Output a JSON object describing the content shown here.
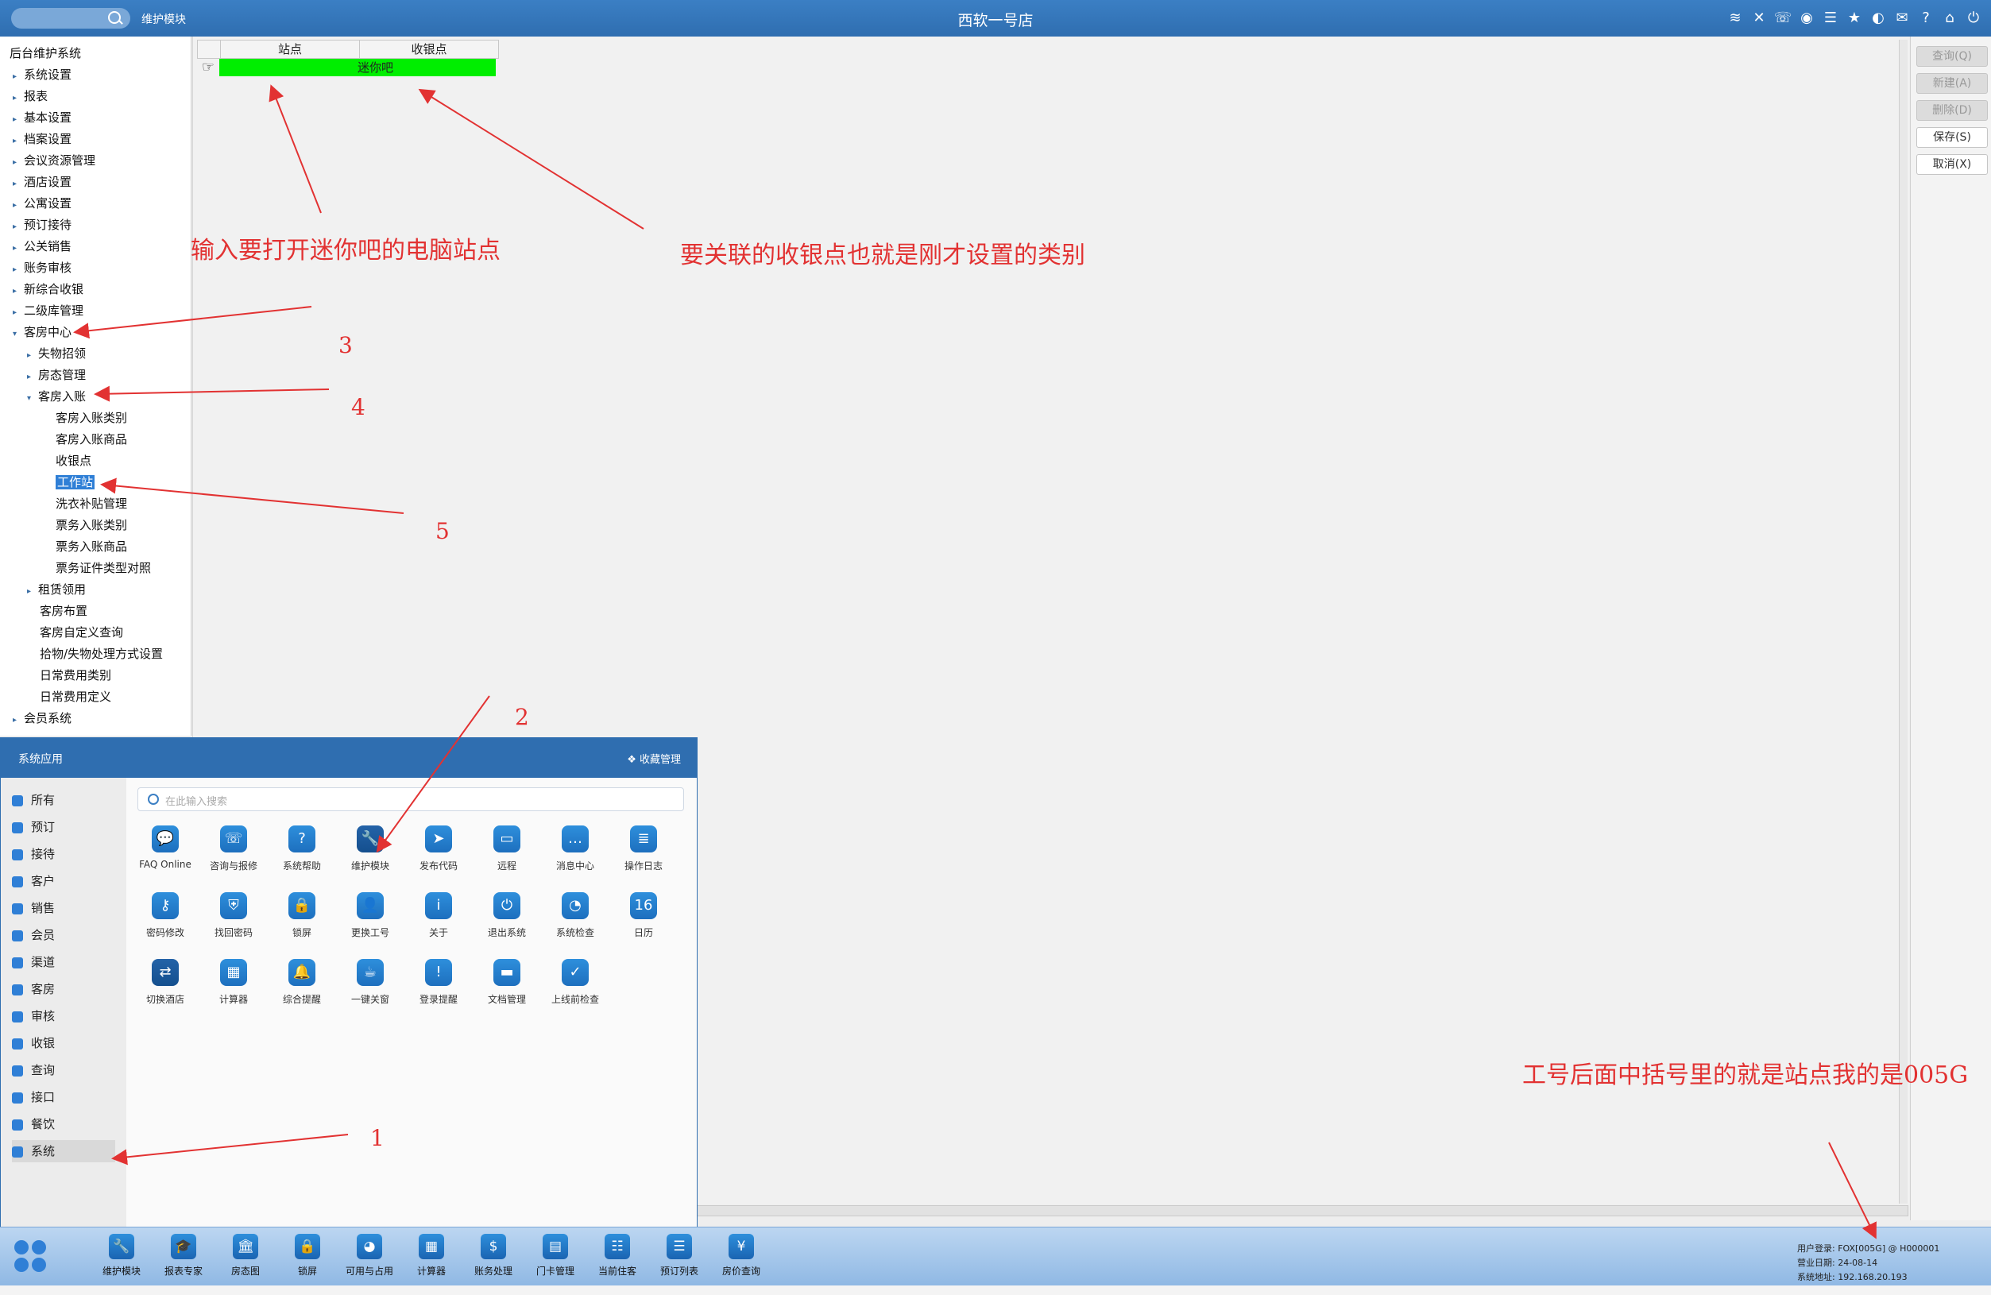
{
  "titlebar": {
    "module_label": "维护模块",
    "window_title": "西软一号店",
    "icons": [
      "wifi-icon",
      "tools-icon",
      "phone-icon",
      "palette-icon",
      "menu-icon",
      "star-icon",
      "moon-icon",
      "mail-icon",
      "help-icon",
      "home-icon",
      "power-icon"
    ]
  },
  "tree": {
    "root": "后台维护系统",
    "items": [
      {
        "label": "系统设置"
      },
      {
        "label": "报表"
      },
      {
        "label": "基本设置"
      },
      {
        "label": "档案设置"
      },
      {
        "label": "会议资源管理"
      },
      {
        "label": "酒店设置"
      },
      {
        "label": "公寓设置"
      },
      {
        "label": "预订接待"
      },
      {
        "label": "公关销售"
      },
      {
        "label": "账务审核"
      },
      {
        "label": "新综合收银"
      },
      {
        "label": "二级库管理"
      },
      {
        "label": "客房中心"
      },
      {
        "label": "失物招领"
      },
      {
        "label": "房态管理"
      },
      {
        "label": "客房入账"
      },
      {
        "label": "客房入账类别"
      },
      {
        "label": "客房入账商品"
      },
      {
        "label": "收银点"
      },
      {
        "label": "工作站"
      },
      {
        "label": "洗衣补贴管理"
      },
      {
        "label": "票务入账类别"
      },
      {
        "label": "票务入账商品"
      },
      {
        "label": "票务证件类型对照"
      },
      {
        "label": "租赁领用"
      },
      {
        "label": "客房布置"
      },
      {
        "label": "客房自定义查询"
      },
      {
        "label": "拾物/失物处理方式设置"
      },
      {
        "label": "日常费用类别"
      },
      {
        "label": "日常费用定义"
      },
      {
        "label": "会员系统"
      }
    ]
  },
  "grid": {
    "headers": [
      "站点",
      "收银点"
    ],
    "row": {
      "station": "",
      "cashier": "迷你吧"
    },
    "highlight_color": "#00ee00"
  },
  "right_buttons": [
    "查询(Q)",
    "新建(A)",
    "删除(D)",
    "保存(S)",
    "取消(X)"
  ],
  "annotations": {
    "a1": "输入要打开迷你吧的电脑站点",
    "a2": "要关联的收银点也就是刚才设置的类别",
    "n3": "3",
    "n4": "4",
    "n5": "5",
    "n2": "2",
    "n1": "1",
    "a3": "工号后面中括号里的就是站点我的是005G"
  },
  "popup": {
    "title": "系统应用",
    "fav": "收藏管理",
    "search_placeholder": "在此输入搜索",
    "categories": [
      "所有",
      "预订",
      "接待",
      "客户",
      "销售",
      "会员",
      "渠道",
      "客房",
      "审核",
      "收银",
      "查询",
      "接口",
      "餐饮",
      "系统"
    ],
    "apps": [
      {
        "label": "FAQ Online",
        "icon": "faq-icon"
      },
      {
        "label": "咨询与报修",
        "icon": "phone-icon"
      },
      {
        "label": "系统帮助",
        "icon": "help-icon"
      },
      {
        "label": "维护模块",
        "icon": "wrench-icon"
      },
      {
        "label": "发布代码",
        "icon": "send-icon"
      },
      {
        "label": "远程",
        "icon": "monitor-icon"
      },
      {
        "label": "消息中心",
        "icon": "chat-icon"
      },
      {
        "label": "操作日志",
        "icon": "log-icon"
      },
      {
        "label": "密码修改",
        "icon": "key-icon"
      },
      {
        "label": "找回密码",
        "icon": "shield-icon"
      },
      {
        "label": "锁屏",
        "icon": "lock-icon"
      },
      {
        "label": "更换工号",
        "icon": "user-icon"
      },
      {
        "label": "关于",
        "icon": "info-icon"
      },
      {
        "label": "退出系统",
        "icon": "power-icon"
      },
      {
        "label": "系统检查",
        "icon": "check-icon"
      },
      {
        "label": "日历",
        "icon": "calendar-icon"
      },
      {
        "label": "切换酒店",
        "icon": "switch-icon"
      },
      {
        "label": "计算器",
        "icon": "calculator-icon"
      },
      {
        "label": "综合提醒",
        "icon": "bell-icon"
      },
      {
        "label": "一键关窗",
        "icon": "close-window-icon"
      },
      {
        "label": "登录提醒",
        "icon": "alert-icon"
      },
      {
        "label": "文档管理",
        "icon": "folder-icon"
      },
      {
        "label": "上线前检查",
        "icon": "shield-check-icon"
      }
    ]
  },
  "taskbar": {
    "apps": [
      "维护模块",
      "报表专家",
      "房态图",
      "锁屏",
      "可用与占用",
      "计算器",
      "账务处理",
      "门卡管理",
      "当前住客",
      "预订列表",
      "房价查询"
    ],
    "status": {
      "user": "用户登录: FOX[005G] @ H000001",
      "date": "营业日期: 24-08-14",
      "ip": "系统地址: 192.168.20.193"
    }
  }
}
